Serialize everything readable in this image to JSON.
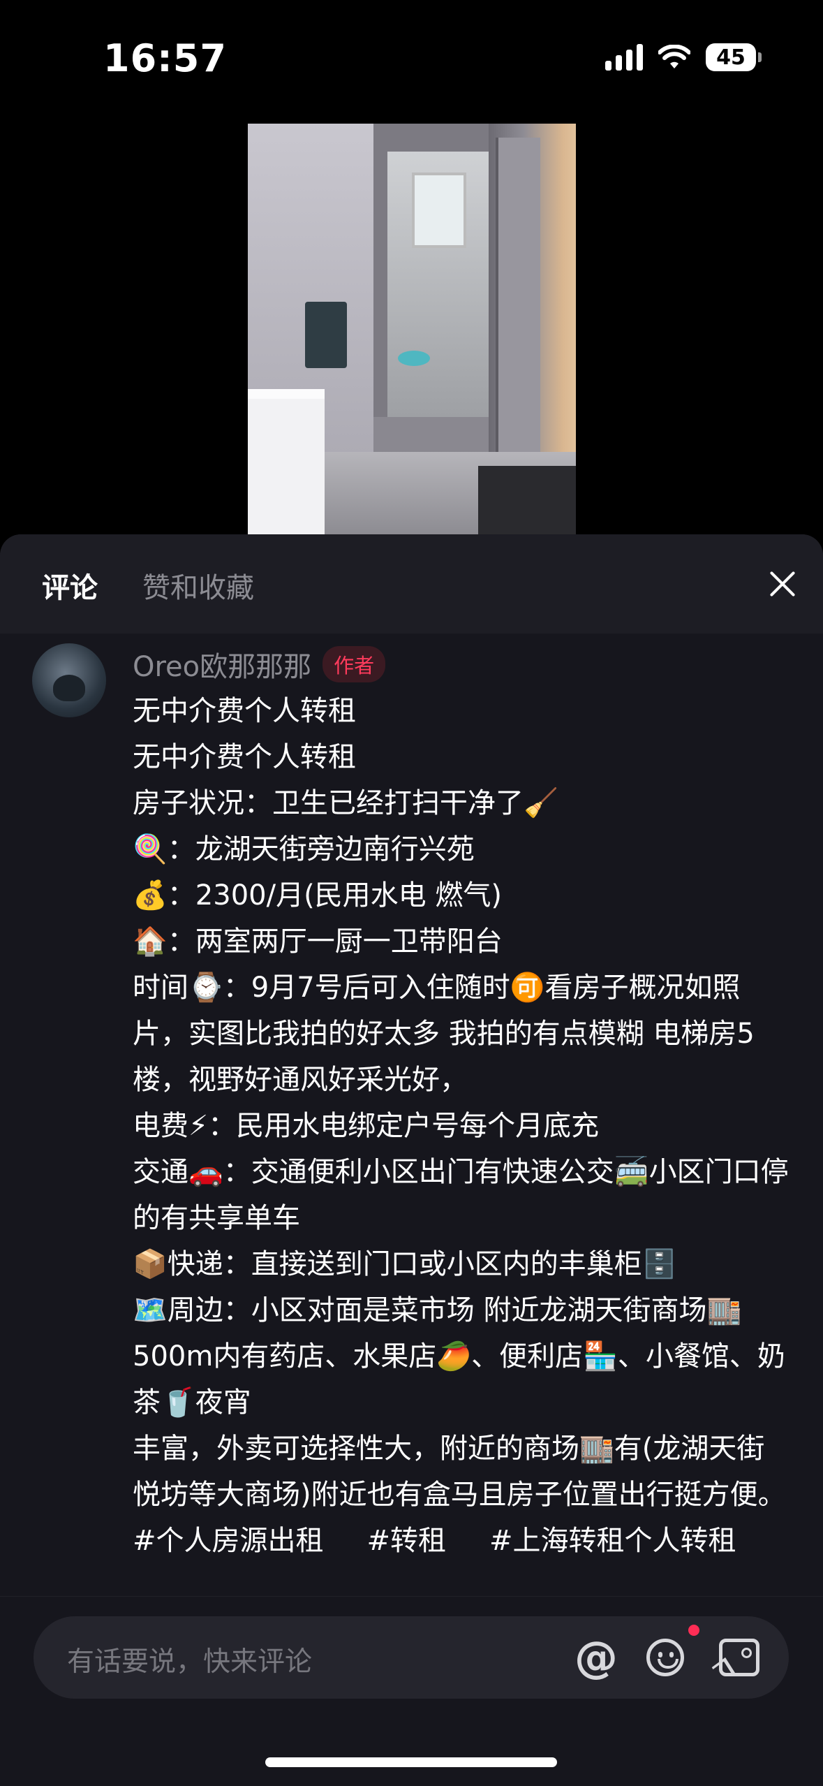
{
  "status_bar": {
    "time": "16:57",
    "battery": "45"
  },
  "tabs": {
    "comments": "评论",
    "likes_favorites": "赞和收藏"
  },
  "author": {
    "name": "Oreo欧那那那",
    "badge": "作者"
  },
  "post_lines": [
    "无中介费个人转租",
    "无中介费个人转租",
    "房子状况：卫生已经打扫干净了🧹",
    "🍭：龙湖天街旁边南行兴苑",
    "💰：2300/月(民用水电 燃气)",
    "🏠：两室两厅一厨一卫带阳台",
    "时间⌚：9月7号后可入住随时🉑看房子概况如照片，实图比我拍的好太多 我拍的有点模糊 电梯房5楼，视野好通风好采光好，",
    "电费⚡：民用水电绑定户号每个月底充",
    "交通🚗：交通便利小区出门有快速公交🚎小区门口停的有共享单车",
    "📦快递：直接送到门口或小区内的丰巢柜🗄️",
    "🗺️周边：小区对面是菜市场 附近龙湖天街商场🏬500m内有药店、水果店🥭、便利店🏪、小餐馆、奶茶🥤夜宵",
    "丰富，外卖可选择性大，附近的商场🏬有(龙湖天街 悦坊等大商场)附近也有盒马且房子位置出行挺方便。"
  ],
  "tags": [
    "#个人房源出租",
    "#转租",
    "#上海转租个人转租"
  ],
  "input": {
    "placeholder": "有话要说，快来评论",
    "at_symbol": "@"
  },
  "colors": {
    "panel_bg": "#16161d",
    "badge_red": "#ff3b5c",
    "muted": "#8c8c93"
  },
  "icons": [
    "wifi-icon",
    "signal-icon",
    "battery-icon",
    "close-icon",
    "at-icon",
    "emoji-icon",
    "image-icon"
  ]
}
